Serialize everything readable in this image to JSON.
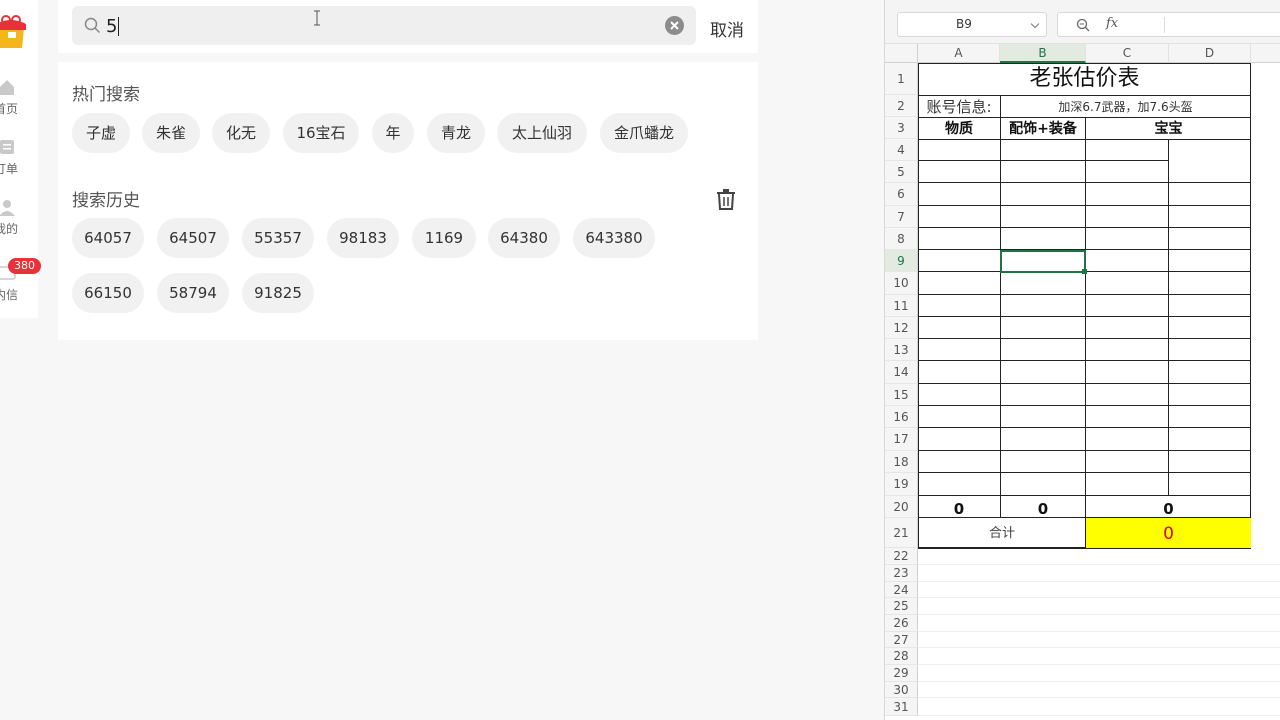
{
  "sidebar": {
    "items": [
      {
        "label": "首页",
        "icon": "home-icon"
      },
      {
        "label": "订单",
        "icon": "order-icon"
      },
      {
        "label": "我的",
        "icon": "user-icon"
      },
      {
        "label": "内信",
        "icon": "message-icon"
      }
    ],
    "badge": "380"
  },
  "search": {
    "value": "5",
    "placeholder": "",
    "cancel_label": "取消"
  },
  "hot": {
    "title": "热门搜索",
    "tags": [
      "子虚",
      "朱雀",
      "化无",
      "16宝石",
      "年",
      "青龙",
      "太上仙羽",
      "金爪蟠龙"
    ]
  },
  "history": {
    "title": "搜索历史",
    "tags": [
      "64057",
      "64507",
      "55357",
      "98183",
      "1169",
      "64380",
      "643380",
      "66150",
      "58794",
      "91825"
    ]
  },
  "sheet": {
    "name_box": "B9",
    "fx": "fx",
    "columns": [
      "A",
      "B",
      "C",
      "D"
    ],
    "rows": [
      "1",
      "2",
      "3",
      "4",
      "5",
      "6",
      "7",
      "8",
      "9",
      "10",
      "11",
      "12",
      "13",
      "14",
      "15",
      "16",
      "17",
      "18",
      "19",
      "20",
      "21",
      "22",
      "23",
      "24",
      "25",
      "26",
      "27",
      "28",
      "29",
      "30",
      "31"
    ],
    "title": "老张估价表",
    "account_label": "账号信息:",
    "account_value": "加深6.7武器，加7.6头盔",
    "headers": [
      "物质",
      "配饰+装备",
      "宝宝"
    ],
    "totals": [
      "0",
      "0",
      "0"
    ],
    "sum_label": "合计",
    "sum_value": "0",
    "colors": {
      "selection": "#217346",
      "highlight": "#ffff00",
      "sum_text": "#e00000",
      "badge": "#e8313b"
    }
  }
}
